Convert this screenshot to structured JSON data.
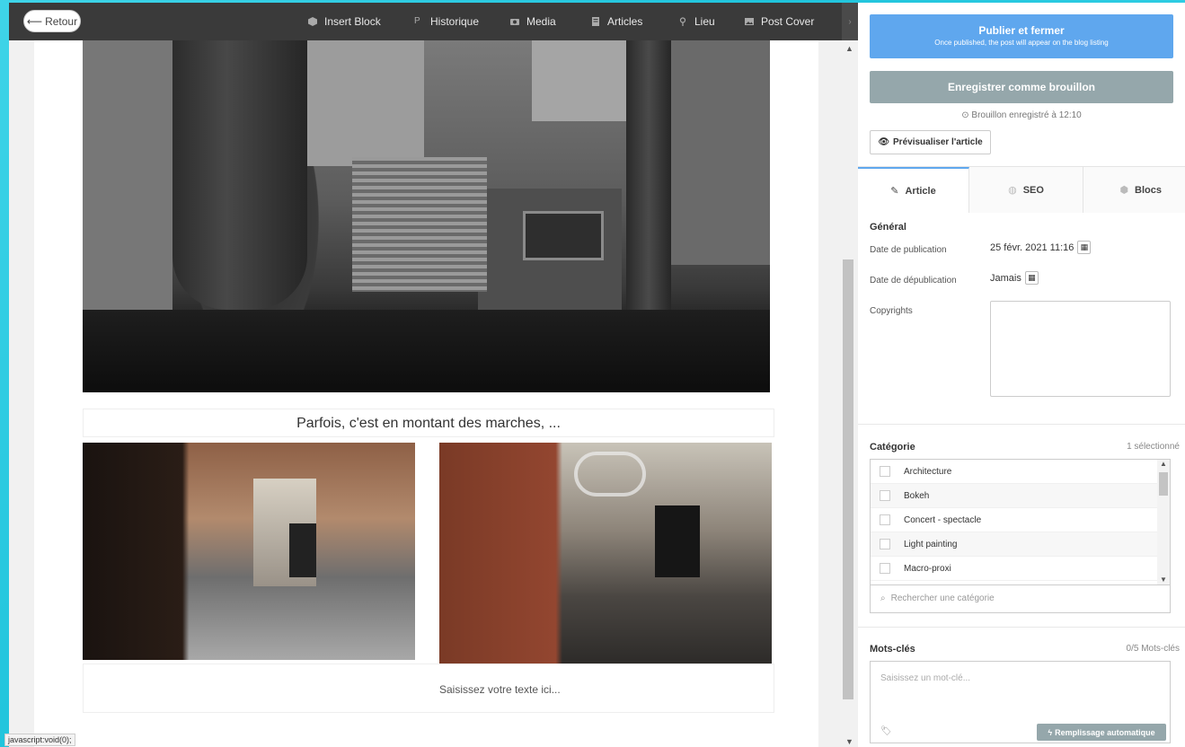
{
  "editor": {
    "back_label": "Retour",
    "toolbar": [
      {
        "label": "Insert Block",
        "icon": "cube-icon"
      },
      {
        "label": "Historique",
        "icon": "history-icon"
      },
      {
        "label": "Media",
        "icon": "camera-icon"
      },
      {
        "label": "Articles",
        "icon": "document-icon"
      },
      {
        "label": "Lieu",
        "icon": "pin-icon"
      },
      {
        "label": "Post Cover",
        "icon": "image-icon"
      }
    ],
    "caption": "Parfois, c'est en montant des marches, ...",
    "image_text": "Saisissez votre texte ici...",
    "status_tip": "javascript:void(0);"
  },
  "panel": {
    "publish_title": "Publier et fermer",
    "publish_sub": "Once published, the post will appear on the blog listing",
    "draft_label": "Enregistrer comme brouillon",
    "draft_status": "Brouillon enregistré à 12:10",
    "preview_label": "Prévisualiser l'article",
    "tabs": [
      {
        "label": "Article",
        "icon": "pencil-icon",
        "active": true
      },
      {
        "label": "SEO",
        "icon": "globe-icon",
        "active": false
      },
      {
        "label": "Blocs",
        "icon": "cube-icon",
        "active": false
      }
    ],
    "general": {
      "title": "Général",
      "pub_date_label": "Date de publication",
      "pub_date_value": "25 févr. 2021 11:16",
      "unpub_date_label": "Date de dépublication",
      "unpub_date_value": "Jamais",
      "copyrights_label": "Copyrights"
    },
    "category": {
      "title": "Catégorie",
      "count": "1 sélectionné",
      "items": [
        "Architecture",
        "Bokeh",
        "Concert - spectacle",
        "Light painting",
        "Macro-proxi"
      ],
      "search_placeholder": "Rechercher une catégorie"
    },
    "keywords": {
      "title": "Mots-clés",
      "count": "0/5 Mots-clés",
      "placeholder": "Saisissez un mot-clé...",
      "autofill_label": "Remplissage automatique"
    }
  },
  "colors": {
    "publish": "#5fa7ee",
    "secondary": "#95a7ab",
    "toolbar_bg": "#3a3a3a",
    "frame_bg": "#2cc9e0"
  }
}
